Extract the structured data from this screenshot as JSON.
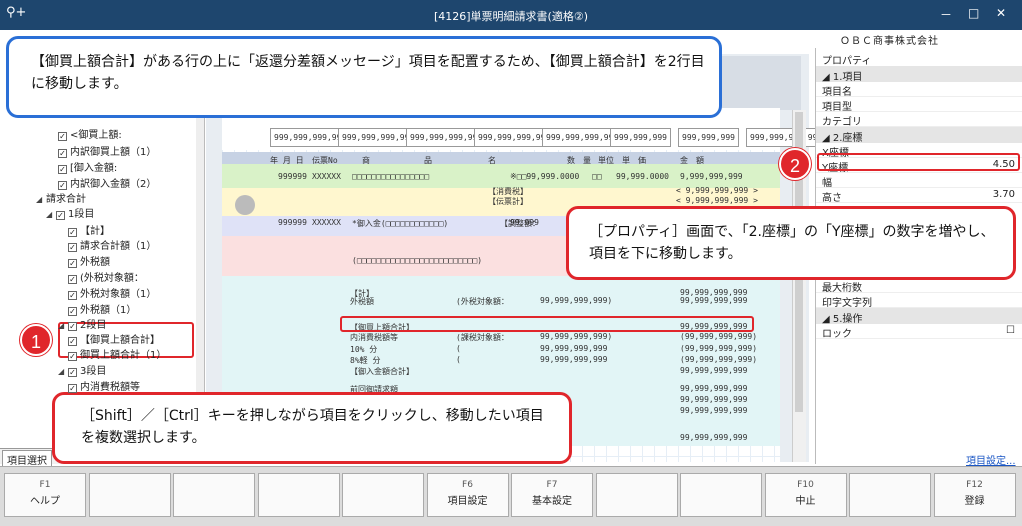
{
  "window": {
    "title": "[4126]単票明細請求書(適格②)",
    "company": "ＯＢＣ商事株式会社",
    "search_icon": "search-add-icon",
    "minimize": "－",
    "maximize": "□",
    "close": "✕"
  },
  "tree": {
    "items": [
      {
        "label": "<御買上額:",
        "checked": true
      },
      {
        "label": "内訳御買上額（1）",
        "checked": true
      },
      {
        "label": "[御入金額:",
        "checked": true
      },
      {
        "label": "内訳御入金額（2）",
        "checked": true
      },
      {
        "label": "請求合計"
      },
      {
        "label": "1段目",
        "checked": true
      },
      {
        "label": "【計】",
        "checked": true
      },
      {
        "label": "請求合計額（1）",
        "checked": true
      },
      {
        "label": "外税額",
        "checked": true
      },
      {
        "label": "(外税対象額：",
        "checked": true
      },
      {
        "label": "外税対象額（1）",
        "checked": true
      },
      {
        "label": "外税額（1）",
        "checked": true
      },
      {
        "label": "2段目",
        "checked": true
      },
      {
        "label": "【御買上額合計】",
        "checked": true
      },
      {
        "label": "御買上額合計（1）",
        "checked": true
      },
      {
        "label": "3段目",
        "checked": true
      },
      {
        "label": "内消費税額等",
        "checked": true
      }
    ],
    "tab_label": "項目選択"
  },
  "sheet": {
    "header_amounts": [
      "999,999,999,999",
      "999,999,999,999",
      "999,999,999,999",
      "999,999,999,999",
      "999,999,999,999",
      "999,999,999",
      "999,999,999",
      "999,999,999,999"
    ],
    "columns": [
      "年 月 日",
      "伝票No",
      "商",
      "品",
      "名",
      "数　量",
      "単位",
      "単　価",
      "金　額"
    ],
    "rows": [
      {
        "date": "999999",
        "slip": "XXXXXX",
        "item": "□□□□□□□□□□□□□□□□",
        "qty": "※□□99,999.0000",
        "unit": "□□",
        "price": "99,999.0000",
        "amount": "9,999,999,999"
      },
      {
        "label": "【消費税】",
        "amount": "< 9,999,999,999 >"
      },
      {
        "label": "【伝票計】",
        "amount": "< 9,999,999,999 >"
      },
      {
        "date": "999999",
        "slip": "XXXXXX",
        "item": "*御入金(□□□□□□□□□□□□)",
        "extra": "【調整額：",
        "qty": "99,999",
        "amount": "9,999,999,999"
      },
      {
        "item": "(□□□□□□□□□□□□□□□□□□□□□□□□□)",
        "amount": "9,999,999,999"
      },
      {
        "label": "【計】",
        "amount": "99,999,999,999"
      },
      {
        "label": "外税額",
        "note": "(外税対象額：",
        "value": "99,999,999,999)",
        "amount": "99,999,999,999"
      },
      {
        "label": "【御買上額合計】",
        "amount": "99,999,999,999"
      },
      {
        "label": "内消費税額等",
        "note": "(課税対象額：",
        "value": "99,999,999,999)",
        "amount": "(99,999,999,999)"
      },
      {
        "label": "10% 分",
        "note": "(",
        "value": "99,999,999,999",
        "amount": "(99,999,999,999)"
      },
      {
        "label": "8%軽 分",
        "note": "(",
        "value": "99,999,999,999",
        "amount": "(99,999,999,999)"
      },
      {
        "label": "【御入金額合計】",
        "amount": "99,999,999,999"
      },
      {
        "label": "前回御請求額",
        "amount": "99,999,999,999"
      },
      {
        "amount": "99,999,999,999"
      },
      {
        "amount": "99,999,999,999"
      },
      {
        "item": "□□□□□□□□□□□□□□□□□□□□□",
        "amount": "99,999,999,999"
      }
    ]
  },
  "properties": {
    "title": "プロパティ",
    "sections": [
      {
        "header": "1.項目",
        "rows": [
          {
            "name": "項目名"
          },
          {
            "name": "項目型"
          },
          {
            "name": "カテゴリ"
          }
        ]
      },
      {
        "header": "2.座標",
        "rows": [
          {
            "name": "X座標"
          },
          {
            "name": "Y座標",
            "value": "4.50"
          },
          {
            "name": "幅"
          },
          {
            "name": "高さ",
            "value": "3.70"
          }
        ]
      },
      {
        "header": "",
        "rows": [
          {
            "name": "最大桁数"
          },
          {
            "name": "印字文字列"
          }
        ]
      },
      {
        "header": "5.操作",
        "rows": [
          {
            "name": "ロック",
            "value": "☐"
          }
        ]
      }
    ],
    "link": "項目設定..."
  },
  "fkeys": [
    {
      "key": "F1",
      "label": "ヘルプ"
    },
    {
      "key": "",
      "label": ""
    },
    {
      "key": "",
      "label": ""
    },
    {
      "key": "",
      "label": ""
    },
    {
      "key": "",
      "label": ""
    },
    {
      "key": "F6",
      "label": "項目設定"
    },
    {
      "key": "F7",
      "label": "基本設定"
    },
    {
      "key": "",
      "label": ""
    },
    {
      "key": "",
      "label": ""
    },
    {
      "key": "F10",
      "label": "中止"
    },
    {
      "key": "",
      "label": ""
    },
    {
      "key": "F12",
      "label": "登録"
    }
  ],
  "callouts": {
    "top": "【御買上額合計】がある行の上に「返還分差額メッセージ」項目を配置するため、【御買上額合計】を2行目に移動します。",
    "property": "［プロパティ］画面で、「2.座標」の「Y座標」の数字を増やし、項目を下に移動します。",
    "select": "［Shift］／［Ctrl］キーを押しながら項目をクリックし、移動したい項目を複数選択します。",
    "badge1": "1",
    "badge2": "2"
  },
  "colors": {
    "titlebar": "#1e466e",
    "callout_blue": "#2a6fd6",
    "callout_red": "#e0262b",
    "badge": "#e0262b"
  }
}
